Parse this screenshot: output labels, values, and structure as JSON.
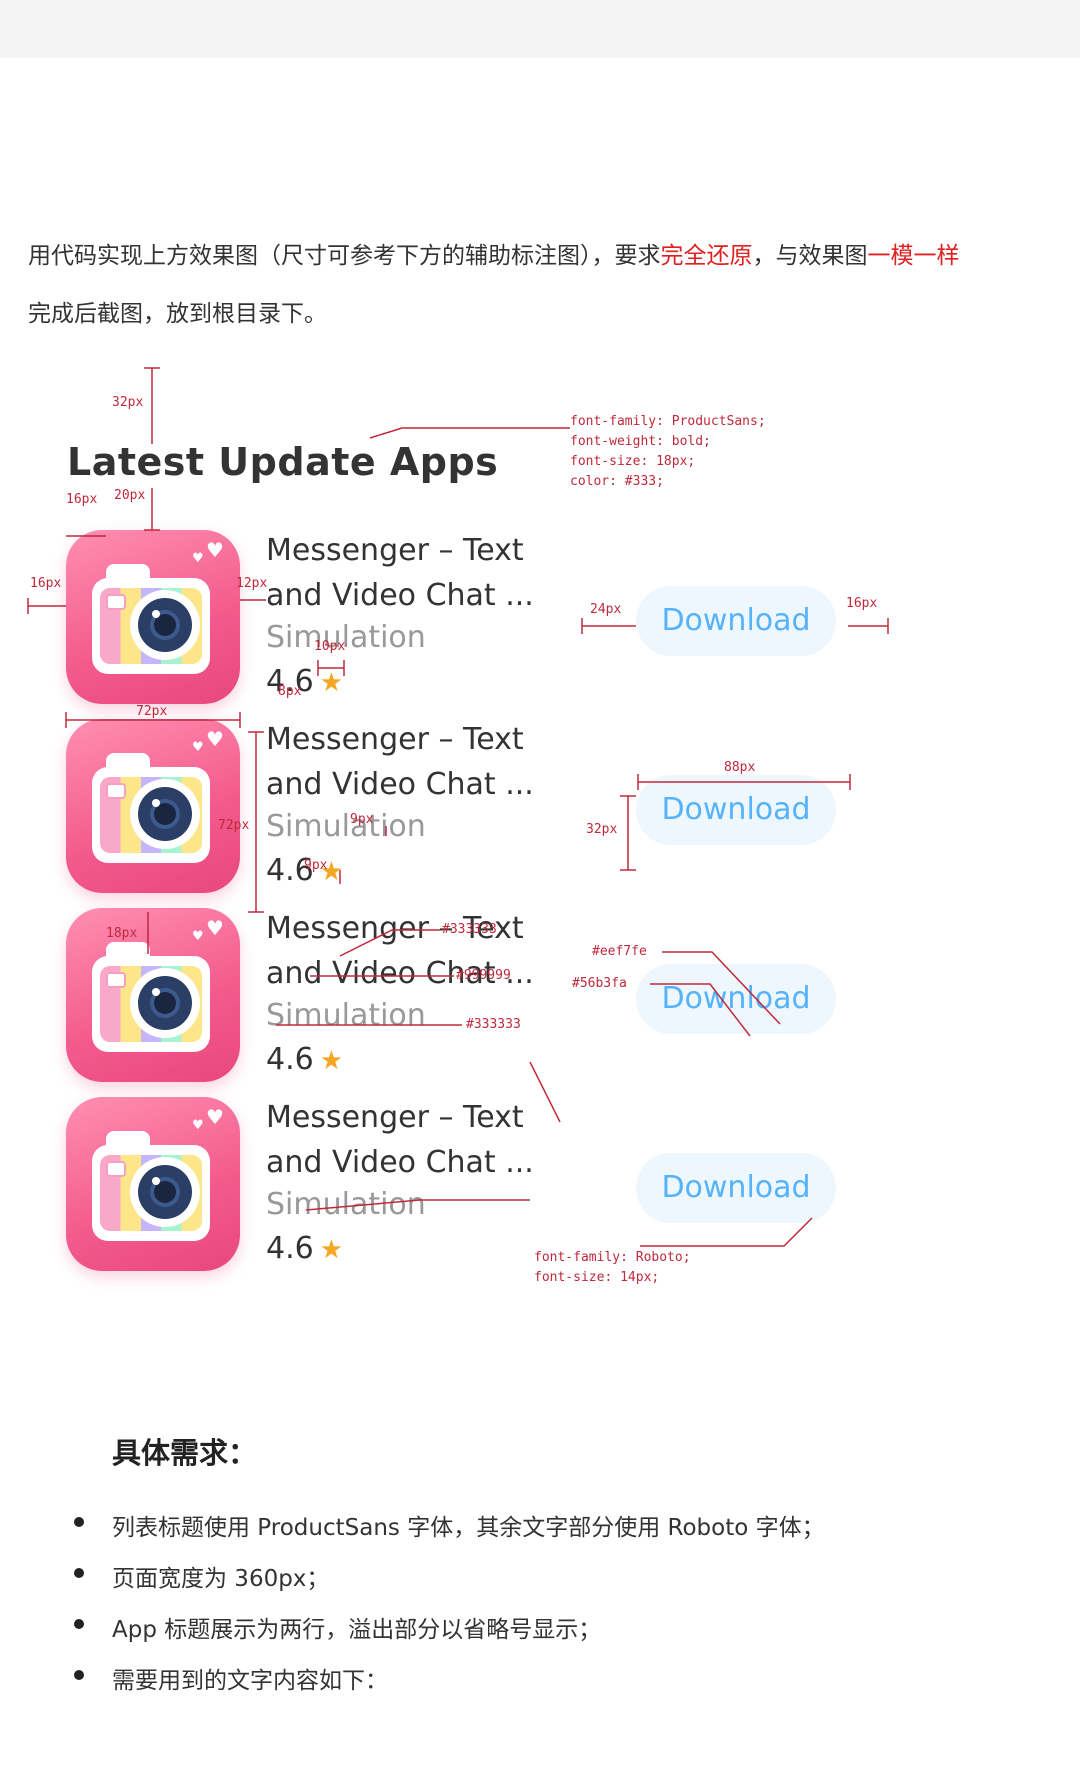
{
  "intro": {
    "line1_a": "用代码实现上方效果图（尺寸可参考下方的辅助标注图），要求",
    "line1_red1": "完全还原",
    "line1_b": "，与效果图",
    "line1_red2": "一模一样",
    "line2": "完成后截图，放到根目录下。"
  },
  "section_title": "Latest Update Apps",
  "apps": [
    {
      "title_l1": "Messenger – Text",
      "title_l2": "and Video Chat ...",
      "subtitle": "Simulation",
      "rating": "4.6",
      "button": "Download"
    },
    {
      "title_l1": "Messenger – Text",
      "title_l2": "and Video Chat ...",
      "subtitle": "Simulation",
      "rating": "4.6",
      "button": "Download"
    },
    {
      "title_l1": "Messenger – Text",
      "title_l2": "and Video Chat ...",
      "subtitle": "Simulation",
      "rating": "4.6",
      "button": "Download"
    },
    {
      "title_l1": "Messenger – Text",
      "title_l2": "and Video Chat ...",
      "subtitle": "Simulation",
      "rating": "4.6",
      "button": "Download"
    }
  ],
  "annotations": {
    "title_spec": [
      "font-family: ProductSans;",
      "font-weight: bold;",
      "font-size: 18px;",
      "color: #333;"
    ],
    "d32": "32px",
    "d16a": "16px",
    "d20": "20px",
    "d16b": "16px",
    "d12": "12px",
    "d10": "10px",
    "d8": "8px",
    "d72w": "72px",
    "d24": "24px",
    "d16c": "16px",
    "d88": "88px",
    "d32h": "32px",
    "d72h": "72px",
    "d9a": "9px",
    "d9b": "9px",
    "d18": "18px",
    "c333a": "#333333",
    "c999": "#999999",
    "c333b": "#333333",
    "c_eef": "#eef7fe",
    "c_56b": "#56b3fa",
    "body_spec": [
      "font-family: Roboto;",
      "font-size: 14px;"
    ]
  },
  "requirements": {
    "title": "具体需求：",
    "items": [
      "列表标题使用 ProductSans 字体，其余文字部分使用 Roboto 字体；",
      "页面宽度为 360px；",
      "App 标题展示为两行，溢出部分以省略号显示；",
      "需要用到的文字内容如下："
    ]
  },
  "colors": {
    "title": "#333333",
    "subtitle": "#999999",
    "button_bg": "#eef7fe",
    "button_text": "#56b3fa",
    "star": "#f5a623",
    "annotation": "#c0293a",
    "emphasis": "#e02020"
  }
}
